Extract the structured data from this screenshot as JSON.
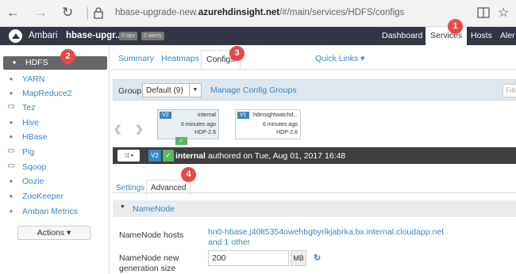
{
  "browser": {
    "back_icon": "arrow-left-icon",
    "forward_icon": "arrow-right-icon",
    "refresh_icon": "refresh-icon",
    "lock_icon": "lock-icon",
    "url_prefix": "hbase-upgrade-new.",
    "url_domain": "azurehdinsight.net",
    "url_path": "/#/main/services/HDFS/configs",
    "reading_icon": "reading-view-icon",
    "favorite_icon": "star-icon"
  },
  "topbar": {
    "app_name": "Ambari",
    "cluster_name": "hbase-upgr...",
    "ops_badge": "0 ops",
    "alerts_badge": "0 alerts",
    "nav": [
      "Dashboard",
      "Services",
      "Hosts",
      "Aler"
    ],
    "active_nav": "Services"
  },
  "markers": [
    "1",
    "2",
    "3",
    "4"
  ],
  "sidebar": {
    "items": [
      {
        "label": "HDFS",
        "icon": "check-circle-icon"
      },
      {
        "label": "YARN",
        "icon": "check-circle-icon"
      },
      {
        "label": "MapReduce2",
        "icon": "check-circle-icon"
      },
      {
        "label": "Tez",
        "icon": "laptop-icon"
      },
      {
        "label": "Hive",
        "icon": "check-circle-icon"
      },
      {
        "label": "HBase",
        "icon": "check-circle-icon"
      },
      {
        "label": "Pig",
        "icon": "laptop-icon"
      },
      {
        "label": "Sqoop",
        "icon": "laptop-icon"
      },
      {
        "label": "Oozie",
        "icon": "check-circle-icon"
      },
      {
        "label": "ZooKeeper",
        "icon": "check-circle-icon"
      },
      {
        "label": "Ambari Metrics",
        "icon": "check-circle-icon"
      }
    ],
    "actions_label": "Actions ▾"
  },
  "tabs": {
    "summary": "Summary",
    "heatmaps": "Heatmaps",
    "configs": "Configs",
    "quick_links": "Quick Links ▾"
  },
  "group": {
    "label": "Group",
    "selected": "Default (9)",
    "manage": "Manage Config Groups",
    "filter_placeholder": "Filte"
  },
  "versions": [
    {
      "tag": "V2",
      "author": "internal",
      "time": "6 minutes ago",
      "stack": "HDP-2.6"
    },
    {
      "tag": "V1",
      "author": "hdinsightwatchd...",
      "time": "6 minutes ago",
      "stack": "HDP-2.6"
    }
  ],
  "version_bar": {
    "compare_label": "⤨ ▾",
    "tag": "V2",
    "author": "internal",
    "text": "authored on Tue, Aug 01, 2017 16:48"
  },
  "subtabs": {
    "settings": "Settings",
    "advanced": "Advanced"
  },
  "section": {
    "title": "NameNode"
  },
  "properties": {
    "hosts_label": "NameNode hosts",
    "hosts_value_1": "hn0-hbase.j40lt5354owehbgbyrlkjabrka.bx.internal.cloudapp.net",
    "hosts_value_2": "and 1 other",
    "newgen_label_1": "NameNode new",
    "newgen_label_2": "generation size",
    "newgen_value": "200",
    "newgen_unit": "MB",
    "undo_icon": "undo-icon"
  },
  "colors": {
    "topbar": "#323544",
    "link": "#3a85c2",
    "marker": "#e24a4a",
    "ok": "#5cb85c"
  }
}
